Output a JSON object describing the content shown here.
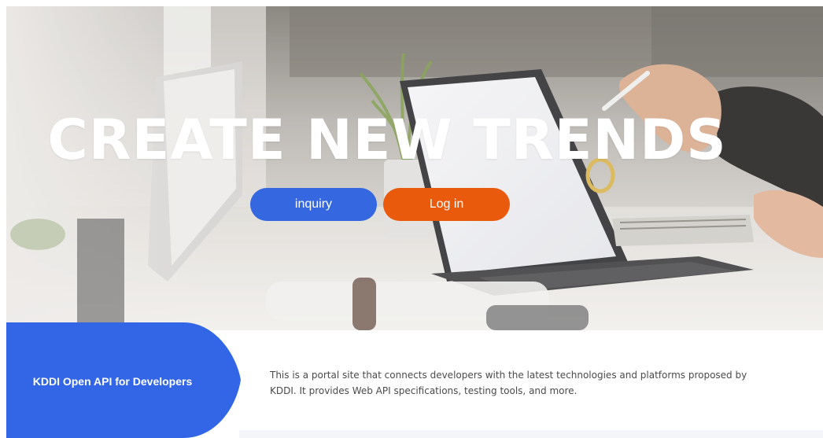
{
  "hero": {
    "title": "CREATE NEW TRENDS",
    "buttons": {
      "inquiry_label": "inquiry",
      "login_label": "Log in"
    }
  },
  "intro": {
    "title": "KDDI Open API for Developers",
    "description": "This is a portal site that connects developers with the latest technologies and platforms proposed by KDDI. It provides Web API specifications, testing tools, and more."
  },
  "colors": {
    "inquiry_button": "#3567e0",
    "login_button": "#ea5a0c",
    "brand_blue": "#3366e6",
    "title_text": "#ffffff"
  }
}
